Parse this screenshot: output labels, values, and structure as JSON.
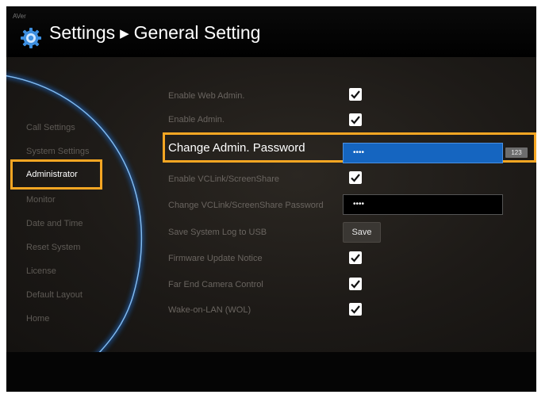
{
  "header": {
    "brand": "AVer",
    "icon": "gear-icon",
    "section": "Settings",
    "page": "General Setting"
  },
  "sidebar": {
    "items": [
      {
        "label": "Call Settings"
      },
      {
        "label": "System Settings"
      },
      {
        "label": "Administrator",
        "active": true
      },
      {
        "label": "Monitor"
      },
      {
        "label": "Date and Time"
      },
      {
        "label": "Reset System"
      },
      {
        "label": "License"
      },
      {
        "label": "Default Layout"
      },
      {
        "label": "Home"
      }
    ]
  },
  "settings": {
    "enable_web_admin": {
      "label": "Enable Web Admin.",
      "checked": true
    },
    "enable_admin": {
      "label": "Enable Admin.",
      "checked": true
    },
    "change_admin_password": {
      "label": "Change Admin. Password",
      "value": "••••",
      "keyboard_mode": "123"
    },
    "enable_vclink": {
      "label": "Enable VCLink/ScreenShare",
      "checked": true
    },
    "change_vclink_password": {
      "label": "Change VCLink/ScreenShare Password",
      "value": "••••"
    },
    "save_log": {
      "label": "Save System Log to USB",
      "button": "Save"
    },
    "firmware_notice": {
      "label": "Firmware Update Notice",
      "checked": true
    },
    "far_end_camera": {
      "label": "Far End Camera Control",
      "checked": true
    },
    "wake_on_lan": {
      "label": "Wake-on-LAN (WOL)",
      "checked": true
    }
  },
  "colors": {
    "highlight": "#f5a623",
    "active_field": "#1565c0",
    "arc_glow": "#4fa3ff"
  }
}
